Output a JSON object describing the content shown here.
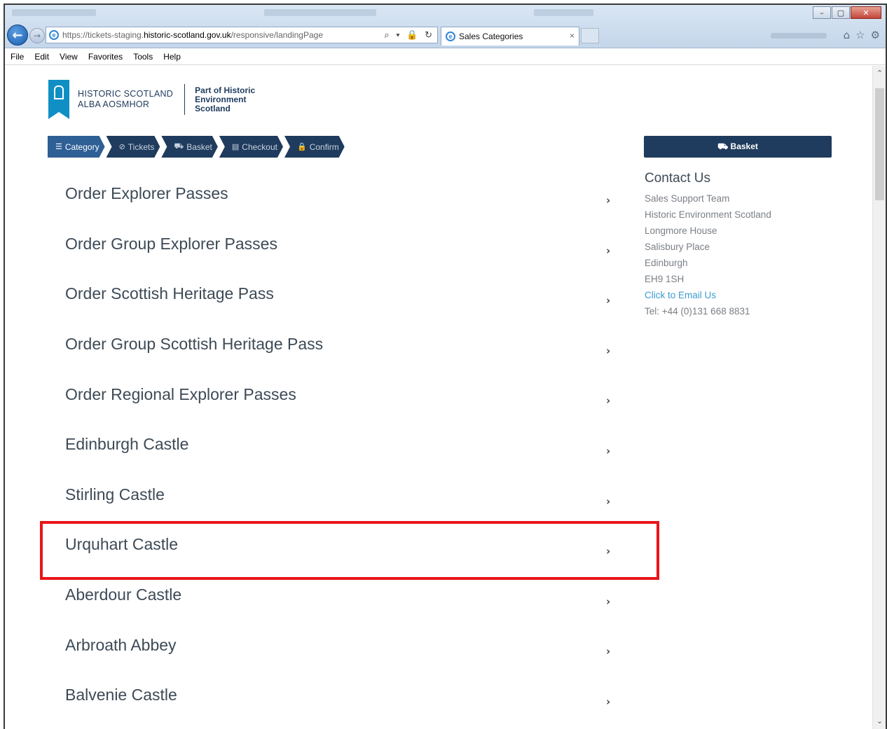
{
  "browser": {
    "url_scheme": "https://",
    "url_host_pre": "tickets-staging.",
    "url_host": "historic-scotland.gov.uk",
    "url_path": "/responsive/landingPage",
    "address_icons": "⌕ ▾ 🔒 ↻",
    "tab_title": "Sales Categories",
    "tab_close": "×",
    "menu": [
      "File",
      "Edit",
      "View",
      "Favorites",
      "Tools",
      "Help"
    ],
    "window_buttons": {
      "minimize": "–",
      "maximize": "▢",
      "close": "✕"
    }
  },
  "logo": {
    "line1": "HISTORIC SCOTLAND",
    "line2": "ALBA AOSMHOR",
    "sub1": "Part of Historic",
    "sub2": "Environment",
    "sub3": "Scotland"
  },
  "steps": [
    {
      "icon": "☰",
      "label": "Category"
    },
    {
      "icon": "⊘",
      "label": "Tickets"
    },
    {
      "icon": "⛟",
      "label": "Basket"
    },
    {
      "icon": "▤",
      "label": "Checkout"
    },
    {
      "icon": "🔒",
      "label": "Confirm"
    }
  ],
  "categories": [
    "Order Explorer Passes",
    "Order Group Explorer Passes",
    "Order Scottish Heritage Pass",
    "Order Group Scottish Heritage Pass",
    "Order Regional Explorer Passes",
    "Edinburgh Castle",
    "Stirling Castle",
    "Urquhart Castle",
    "Aberdour Castle",
    "Arbroath Abbey",
    "Balvenie Castle"
  ],
  "chevron": "›",
  "highlighted_category": "Urquhart Castle",
  "highlight_color": "#e8151a",
  "sidebar": {
    "basket_label": "⛟ Basket",
    "contact_title": "Contact Us",
    "contact_lines": [
      "Sales Support Team",
      "Historic Environment Scotland",
      "Longmore House",
      "Salisbury Place",
      "Edinburgh",
      "EH9 1SH"
    ],
    "email_link": "Click to Email Us",
    "phone": "Tel: +44 (0)131 668 8831"
  },
  "colors": {
    "brand_navy": "#1f3b5d",
    "active_step": "#2e5f95",
    "link_blue": "#3d9bd1"
  }
}
